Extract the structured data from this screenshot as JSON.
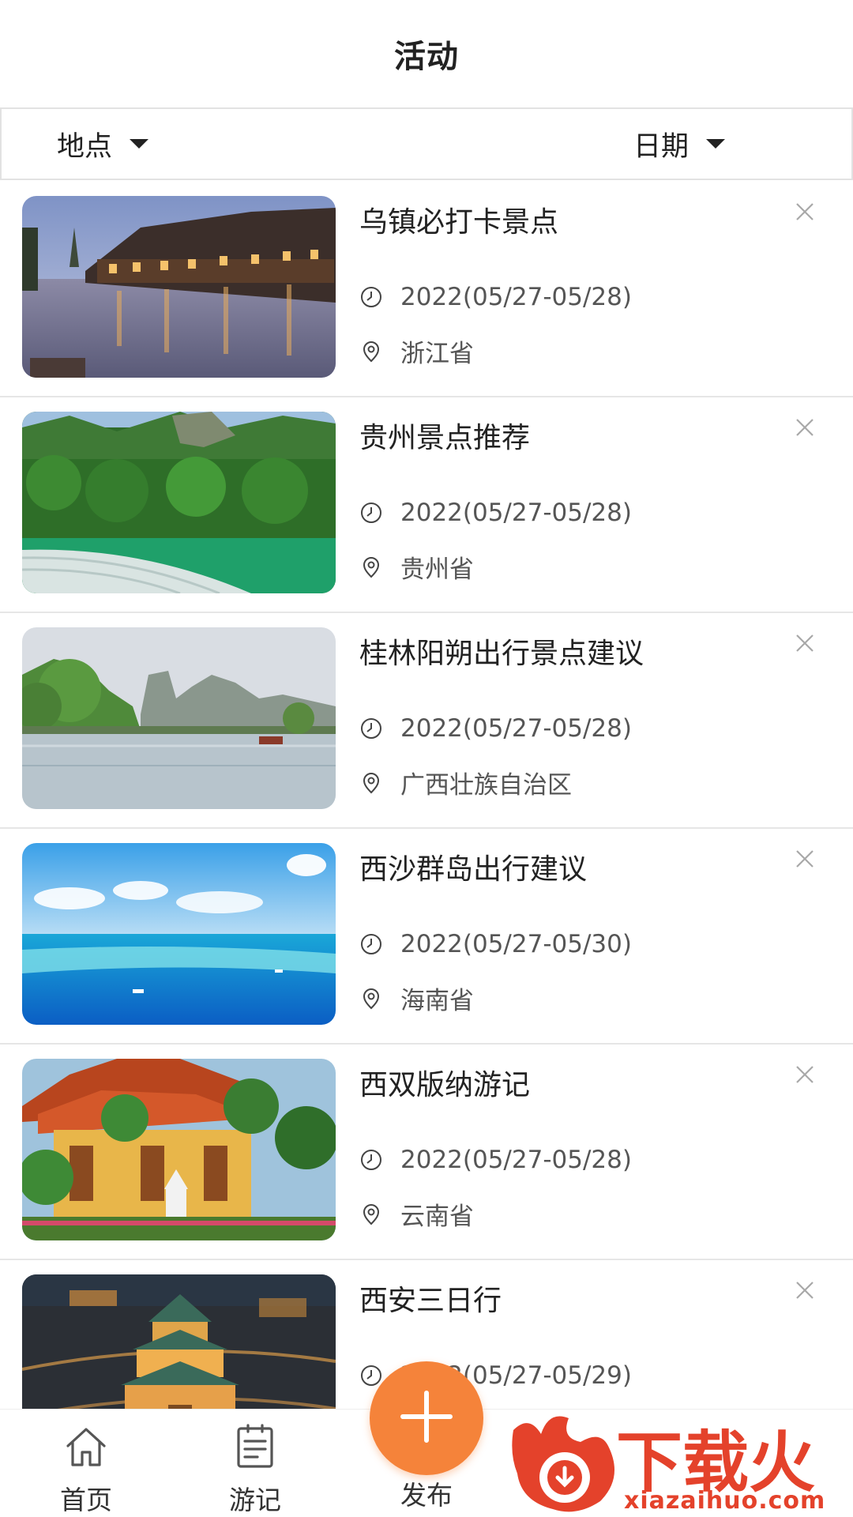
{
  "header": {
    "title": "活动"
  },
  "filters": {
    "location_label": "地点",
    "date_label": "日期"
  },
  "items": [
    {
      "title": "乌镇必打卡景点",
      "date": "2022(05/27-05/28)",
      "location": "浙江省",
      "image": "water-town-night"
    },
    {
      "title": "贵州景点推荐",
      "date": "2022(05/27-05/28)",
      "location": "贵州省",
      "image": "waterfall-forest"
    },
    {
      "title": "桂林阳朔出行景点建议",
      "date": "2022(05/27-05/28)",
      "location": "广西壮族自治区",
      "image": "karst-river"
    },
    {
      "title": "西沙群岛出行建议",
      "date": "2022(05/27-05/30)",
      "location": "海南省",
      "image": "ocean-reef"
    },
    {
      "title": "西双版纳游记",
      "date": "2022(05/27-05/28)",
      "location": "云南省",
      "image": "temple-palms"
    },
    {
      "title": "西安三日行",
      "date": "2022(05/27-05/29)",
      "location": "",
      "image": "bell-tower-night"
    }
  ],
  "tabbar": {
    "home_label": "首页",
    "notes_label": "游记",
    "publish_label": "发布"
  },
  "icons": {
    "caret": "caret-down-icon",
    "close": "close-icon",
    "clock": "clock-icon",
    "location": "location-pin-icon",
    "home": "home-icon",
    "notes": "notes-icon",
    "plus": "plus-icon"
  },
  "colors": {
    "accent": "#f5833a",
    "watermark": "#e4422b"
  },
  "watermark": {
    "text": "下载火",
    "url": "xiazaihuo.com"
  }
}
